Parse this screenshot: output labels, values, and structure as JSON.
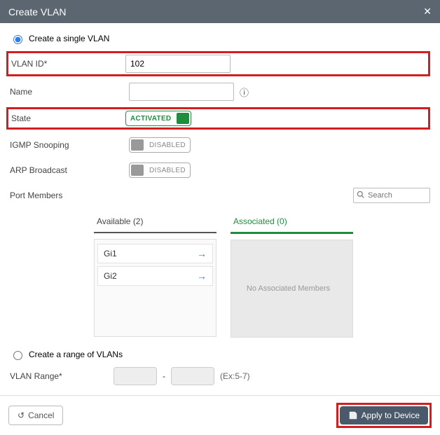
{
  "header": {
    "title": "Create VLAN"
  },
  "mode": {
    "single_label": "Create a single VLAN",
    "range_label": "Create a range of VLANs",
    "selected": "single"
  },
  "form": {
    "vlan_id_label": "VLAN ID*",
    "vlan_id_value": "102",
    "name_label": "Name",
    "name_value": "",
    "state_label": "State",
    "state_value": "ACTIVATED",
    "igmp_label": "IGMP Snooping",
    "igmp_value": "DISABLED",
    "arp_label": "ARP Broadcast",
    "arp_value": "DISABLED",
    "port_members_label": "Port Members",
    "search_placeholder": "Search"
  },
  "transfer": {
    "available_title": "Available (2)",
    "associated_title": "Associated (0)",
    "available_items": [
      "Gi1",
      "Gi2"
    ],
    "empty_msg": "No Associated Members"
  },
  "range": {
    "label": "VLAN Range*",
    "from": "",
    "to": "",
    "example": "(Ex:5-7)"
  },
  "footer": {
    "cancel": "Cancel",
    "apply": "Apply to Device"
  }
}
